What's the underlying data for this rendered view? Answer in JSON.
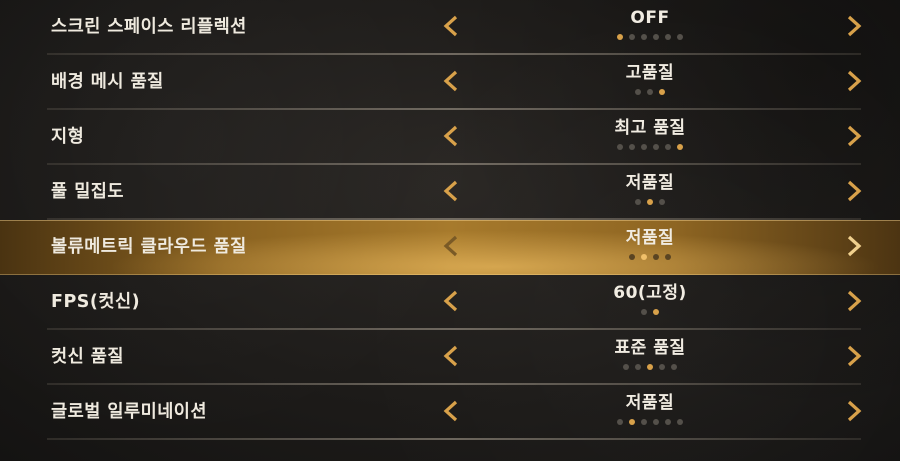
{
  "colors": {
    "accent": "#d8a14a",
    "dot_inactive": "#54504a",
    "text": "#efeadf",
    "selected_highlight": "#a77a2c"
  },
  "icons": {
    "left": "chevron-left-icon",
    "right": "chevron-right-icon"
  },
  "settings": [
    {
      "label": "스크린 스페이스 리플렉션",
      "value": "OFF",
      "levels": 6,
      "active": 0
    },
    {
      "label": "배경 메시 품질",
      "value": "고품질",
      "levels": 3,
      "active": 2
    },
    {
      "label": "지형",
      "value": "최고 품질",
      "levels": 6,
      "active": 5
    },
    {
      "label": "풀 밀집도",
      "value": "저품질",
      "levels": 3,
      "active": 1
    },
    {
      "label": "볼류메트릭 클라우드 품질",
      "value": "저품질",
      "levels": 4,
      "active": 1
    },
    {
      "label": "FPS(컷신)",
      "value": "60(고정)",
      "levels": 2,
      "active": 1
    },
    {
      "label": "컷신 품질",
      "value": "표준 품질",
      "levels": 5,
      "active": 2
    },
    {
      "label": "글로벌 일루미네이션",
      "value": "저품질",
      "levels": 6,
      "active": 1
    }
  ]
}
